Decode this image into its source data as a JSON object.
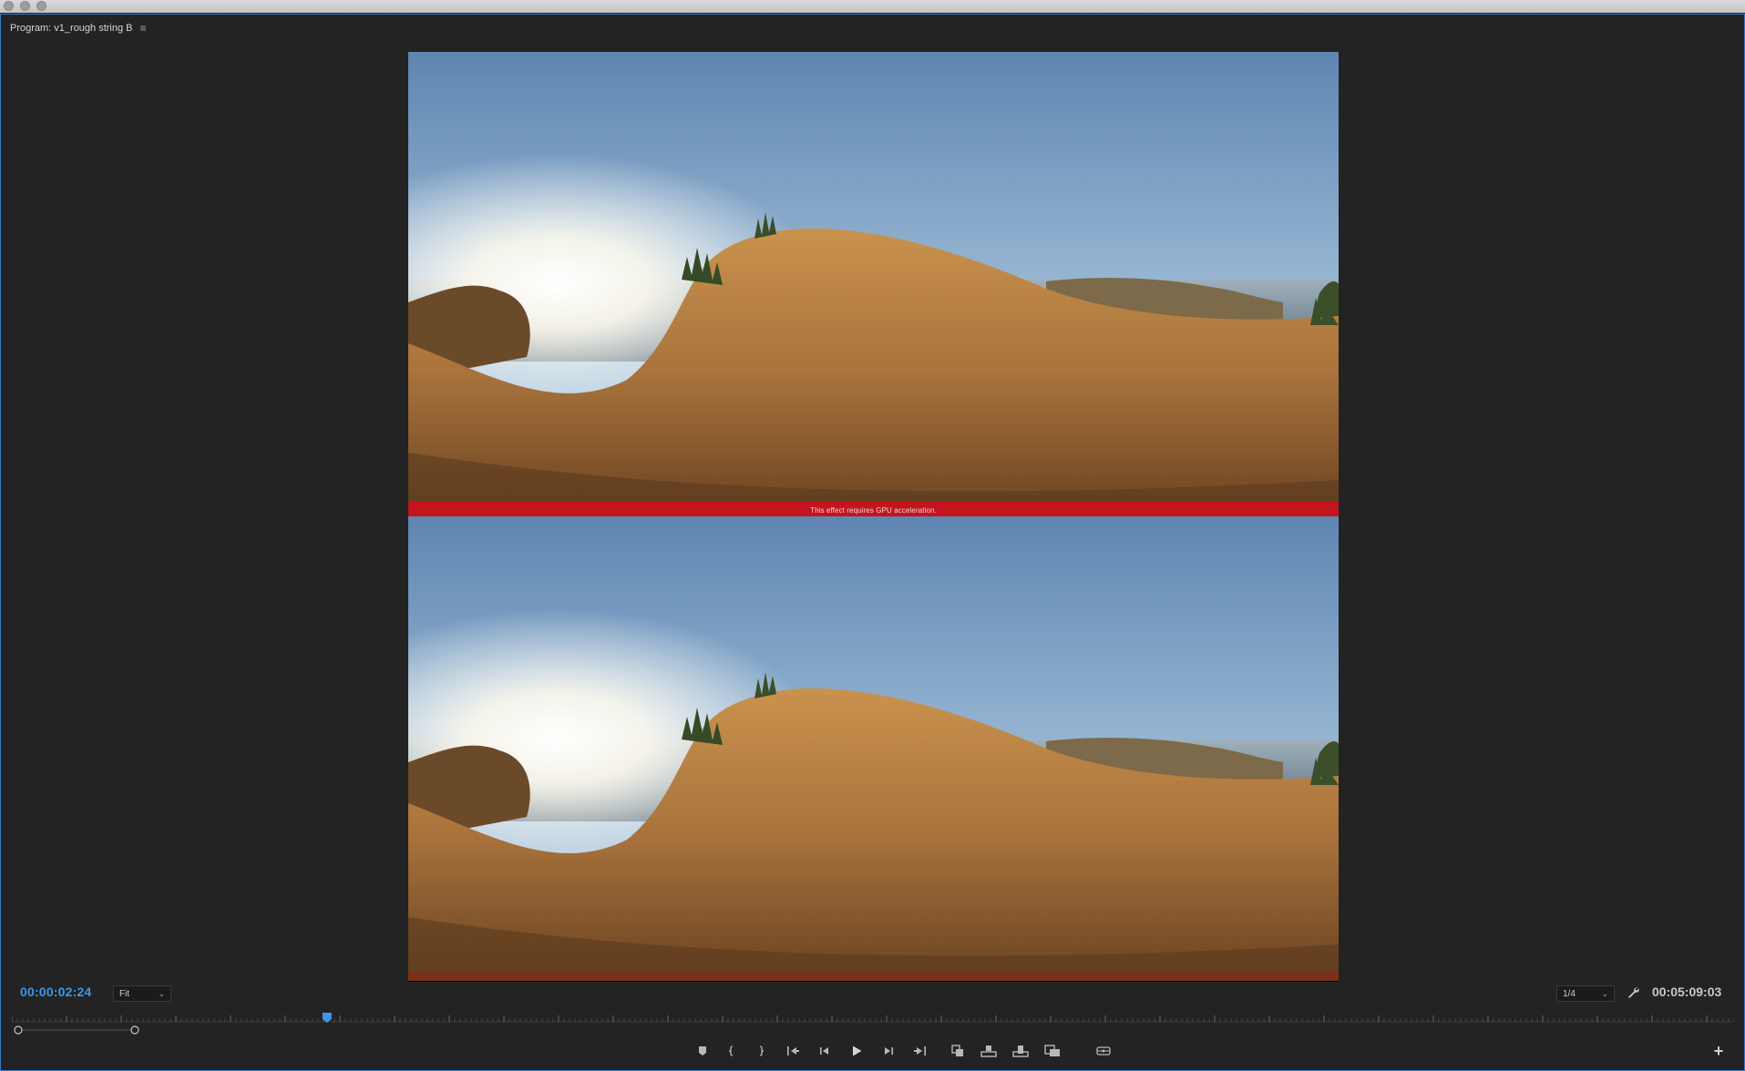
{
  "window": {
    "traffic_lights": [
      "close-button",
      "minimize-button",
      "zoom-button"
    ]
  },
  "panel": {
    "title": "Program: v1_rough string B",
    "menu_icon": "hamburger-icon"
  },
  "viewer": {
    "warning_text": "This effect requires GPU acceleration."
  },
  "controls": {
    "current_timecode": "00:00:02:24",
    "zoom_select_value": "Fit",
    "resolution_select_value": "1/4",
    "duration_timecode": "00:05:09:03",
    "settings_icon": "wrench-icon",
    "playhead_position_fraction": 0.183
  },
  "transport": {
    "buttons": [
      {
        "name": "add-marker-button",
        "icon": "marker-icon"
      },
      {
        "name": "mark-in-button",
        "icon": "mark-in-icon"
      },
      {
        "name": "mark-out-button",
        "icon": "mark-out-icon"
      },
      {
        "name": "go-to-in-button",
        "icon": "go-to-in-icon"
      },
      {
        "name": "step-back-button",
        "icon": "step-back-icon"
      },
      {
        "name": "play-button",
        "icon": "play-icon"
      },
      {
        "name": "step-forward-button",
        "icon": "step-forward-icon"
      },
      {
        "name": "go-to-out-button",
        "icon": "go-to-out-icon"
      },
      {
        "name": "lift-button",
        "icon": "lift-icon"
      },
      {
        "name": "extract-button",
        "icon": "extract-icon"
      },
      {
        "name": "insert-button",
        "icon": "insert-icon"
      },
      {
        "name": "overwrite-button",
        "icon": "overwrite-icon"
      },
      {
        "name": "vr-video-button",
        "icon": "vr-headset-icon"
      }
    ],
    "add_button_icon": "plus-icon"
  },
  "colors": {
    "background": "#232323",
    "accent_blue": "#3b97e8",
    "warning_red": "#c4141e",
    "window_border": "#3a77c8"
  }
}
